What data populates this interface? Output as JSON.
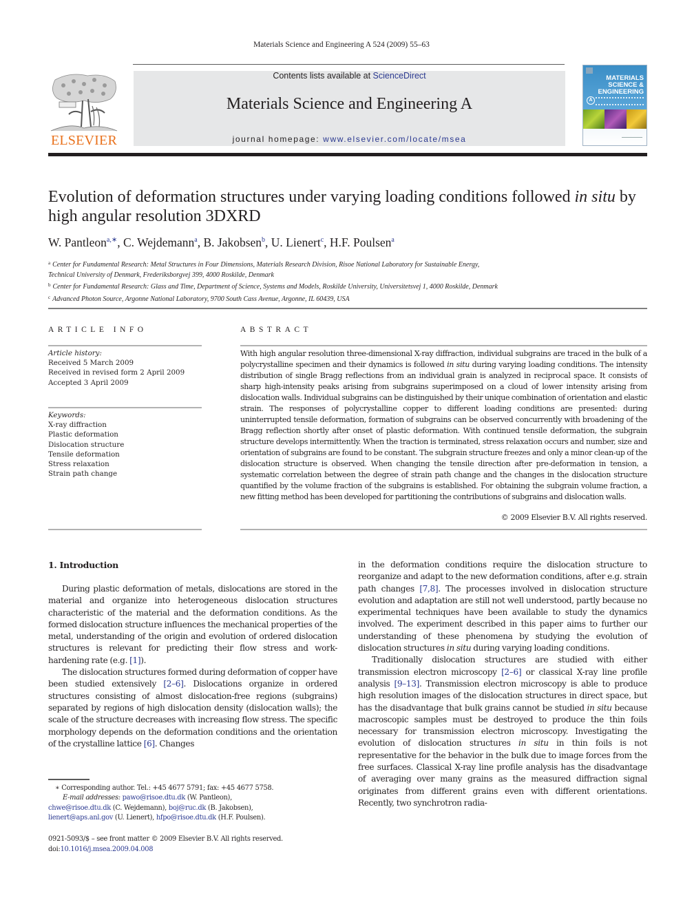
{
  "running_header": "Materials Science and Engineering A 524 (2009) 55–63",
  "publisher": {
    "name": "ELSEVIER",
    "brand_color": "#e9711c"
  },
  "banner": {
    "contents_prefix": "Contents lists available at ",
    "contents_link": "ScienceDirect",
    "journal_title": "Materials Science and Engineering A",
    "homepage_prefix": "journal homepage: ",
    "homepage_link": "www.elsevier.com/locate/msea",
    "background_color": "#e6e7e8",
    "link_color": "#2b3990"
  },
  "cover": {
    "line1": "MATERIALS",
    "line2": "SCIENCE &",
    "line3": "ENGINEERING",
    "series_letter": "A"
  },
  "article": {
    "title_part1": "Evolution of deformation structures under varying loading conditions followed ",
    "title_italic": "in situ",
    "title_part2": " by high angular resolution 3DXRD",
    "authors": [
      {
        "name": "W. Pantleon",
        "affil": "a,∗"
      },
      {
        "name": "C. Wejdemann",
        "affil": "a"
      },
      {
        "name": "B. Jakobsen",
        "affil": "b"
      },
      {
        "name": "U. Lienert",
        "affil": "c"
      },
      {
        "name": "H.F. Poulsen",
        "affil": "a"
      }
    ],
    "affiliations": [
      {
        "key": "a",
        "lines": [
          "Center for Fundamental Research: Metal Structures in Four Dimensions, Materials Research Division, Risoe National Laboratory for Sustainable Energy,",
          "Technical University of Denmark, Frederiksborgvej 399, 4000 Roskilde, Denmark"
        ]
      },
      {
        "key": "b",
        "lines": [
          "Center for Fundamental Research: Glass and Time, Department of Science, Systems and Models, Roskilde University, Universitetsvej 1, 4000 Roskilde, Denmark"
        ]
      },
      {
        "key": "c",
        "lines": [
          "Advanced Photon Source, Argonne National Laboratory, 9700 South Cass Avenue, Argonne, IL 60439, USA"
        ]
      }
    ]
  },
  "article_info": {
    "heading": "ARTICLE INFO",
    "history_label": "Article history:",
    "history": [
      "Received 5 March 2009",
      "Received in revised form 2 April 2009",
      "Accepted 3 April 2009"
    ],
    "keywords_label": "Keywords:",
    "keywords": [
      "X-ray diffraction",
      "Plastic deformation",
      "Dislocation structure",
      "Tensile deformation",
      "Stress relaxation",
      "Strain path change"
    ]
  },
  "abstract": {
    "heading": "ABSTRACT",
    "text_part1": "With high angular resolution three-dimensional X-ray diffraction, individual subgrains are traced in the bulk of a polycrystalline specimen and their dynamics is followed ",
    "text_italic": "in situ",
    "text_part2": " during varying loading conditions. The intensity distribution of single Bragg reflections from an individual grain is analyzed in reciprocal space. It consists of sharp high-intensity peaks arising from subgrains superimposed on a cloud of lower intensity arising from dislocation walls. Individual subgrains can be distinguished by their unique combination of orientation and elastic strain. The responses of polycrystalline copper to different loading conditions are presented: during uninterrupted tensile deformation, formation of subgrains can be observed concurrently with broadening of the Bragg reflection shortly after onset of plastic deformation. With continued tensile deformation, the subgrain structure develops intermittently. When the traction is terminated, stress relaxation occurs and number, size and orientation of subgrains are found to be constant. The subgrain structure freezes and only a minor clean-up of the dislocation structure is observed. When changing the tensile direction after pre-deformation in tension, a systematic correlation between the degree of strain path change and the changes in the dislocation structure quantified by the volume fraction of the subgrains is established. For obtaining the subgrain volume fraction, a new fitting method has been developed for partitioning the contributions of subgrains and dislocation walls.",
    "copyright": "© 2009 Elsevier B.V. All rights reserved."
  },
  "introduction": {
    "heading": "1.  Introduction",
    "left_p1": "During plastic deformation of metals, dislocations are stored in the material and organize into heterogeneous dislocation structures characteristic of the material and the deformation conditions. As the formed dislocation structure influences the mechanical properties of the metal, understanding of the origin and evolution of ordered dislocation structures is relevant for predicting their flow stress and work-hardening rate (e.g. ",
    "left_p1_ref": "[1]",
    "left_p1_end": ").",
    "left_p2_a": "The dislocation structures formed during deformation of copper have been studied extensively ",
    "left_p2_ref1": "[2–6]",
    "left_p2_b": ". Dislocations organize in ordered structures consisting of almost dislocation-free regions (subgrains) separated by regions of high dislocation density (dislocation walls); the scale of the structure decreases with increasing flow stress. The specific morphology depends on the deformation conditions and the orientation of the crystalline lattice ",
    "left_p2_ref2": "[6]",
    "left_p2_c": ". Changes",
    "right_p1_a": "in the deformation conditions require the dislocation structure to reorganize and adapt to the new deformation conditions, after e.g. strain path changes ",
    "right_p1_ref": "[7,8]",
    "right_p1_b": ". The processes involved in dislocation structure evolution and adaptation are still not well understood, partly because no experimental techniques have been available to study the dynamics involved. The experiment described in this paper aims to further our understanding of these phenomena by studying the evolution of dislocation structures ",
    "right_p1_italic": "in situ",
    "right_p1_c": " during varying loading conditions.",
    "right_p2_a": "Traditionally dislocation structures are studied with either transmission electron microscopy ",
    "right_p2_ref1": "[2–6]",
    "right_p2_b": " or classical X-ray line profile analysis ",
    "right_p2_ref2": "[9–13]",
    "right_p2_c": ". Transmission electron microscopy is able to produce high resolution images of the dislocation structures in direct space, but has the disadvantage that bulk grains cannot be studied ",
    "right_p2_italic1": "in situ",
    "right_p2_d": " because macroscopic samples must be destroyed to produce the thin foils necessary for transmission electron microscopy. Investigating the evolution of dislocation structures ",
    "right_p2_italic2": "in situ",
    "right_p2_e": " in thin foils is not representative for the behavior in the bulk due to image forces from the free surfaces. Classical X-ray line profile analysis has the disadvantage of averaging over many grains as the measured diffraction signal originates from different grains even with different orientations. Recently, two synchrotron radia-"
  },
  "footnotes": {
    "corresponding": "∗   Corresponding author. Tel.: +45 4677 5791; fax: +45 4677 5758.",
    "email_label": "E-mail addresses:",
    "emails": [
      {
        "address": "pawo@risoe.dtu.dk",
        "owner": " (W. Pantleon),"
      },
      {
        "address": "chwe@risoe.dtu.dk",
        "owner": " (C. Wejdemann), "
      },
      {
        "address": "boj@ruc.dk",
        "owner": " (B. Jakobsen),"
      },
      {
        "address": "lienert@aps.anl.gov",
        "owner": " (U. Lienert), "
      },
      {
        "address": "hfpo@risoe.dtu.dk",
        "owner": " (H.F. Poulsen)."
      }
    ],
    "front_matter": "0921-5093/$ – see front matter © 2009 Elsevier B.V. All rights reserved.",
    "doi_label": "doi:",
    "doi": "10.1016/j.msea.2009.04.008"
  }
}
